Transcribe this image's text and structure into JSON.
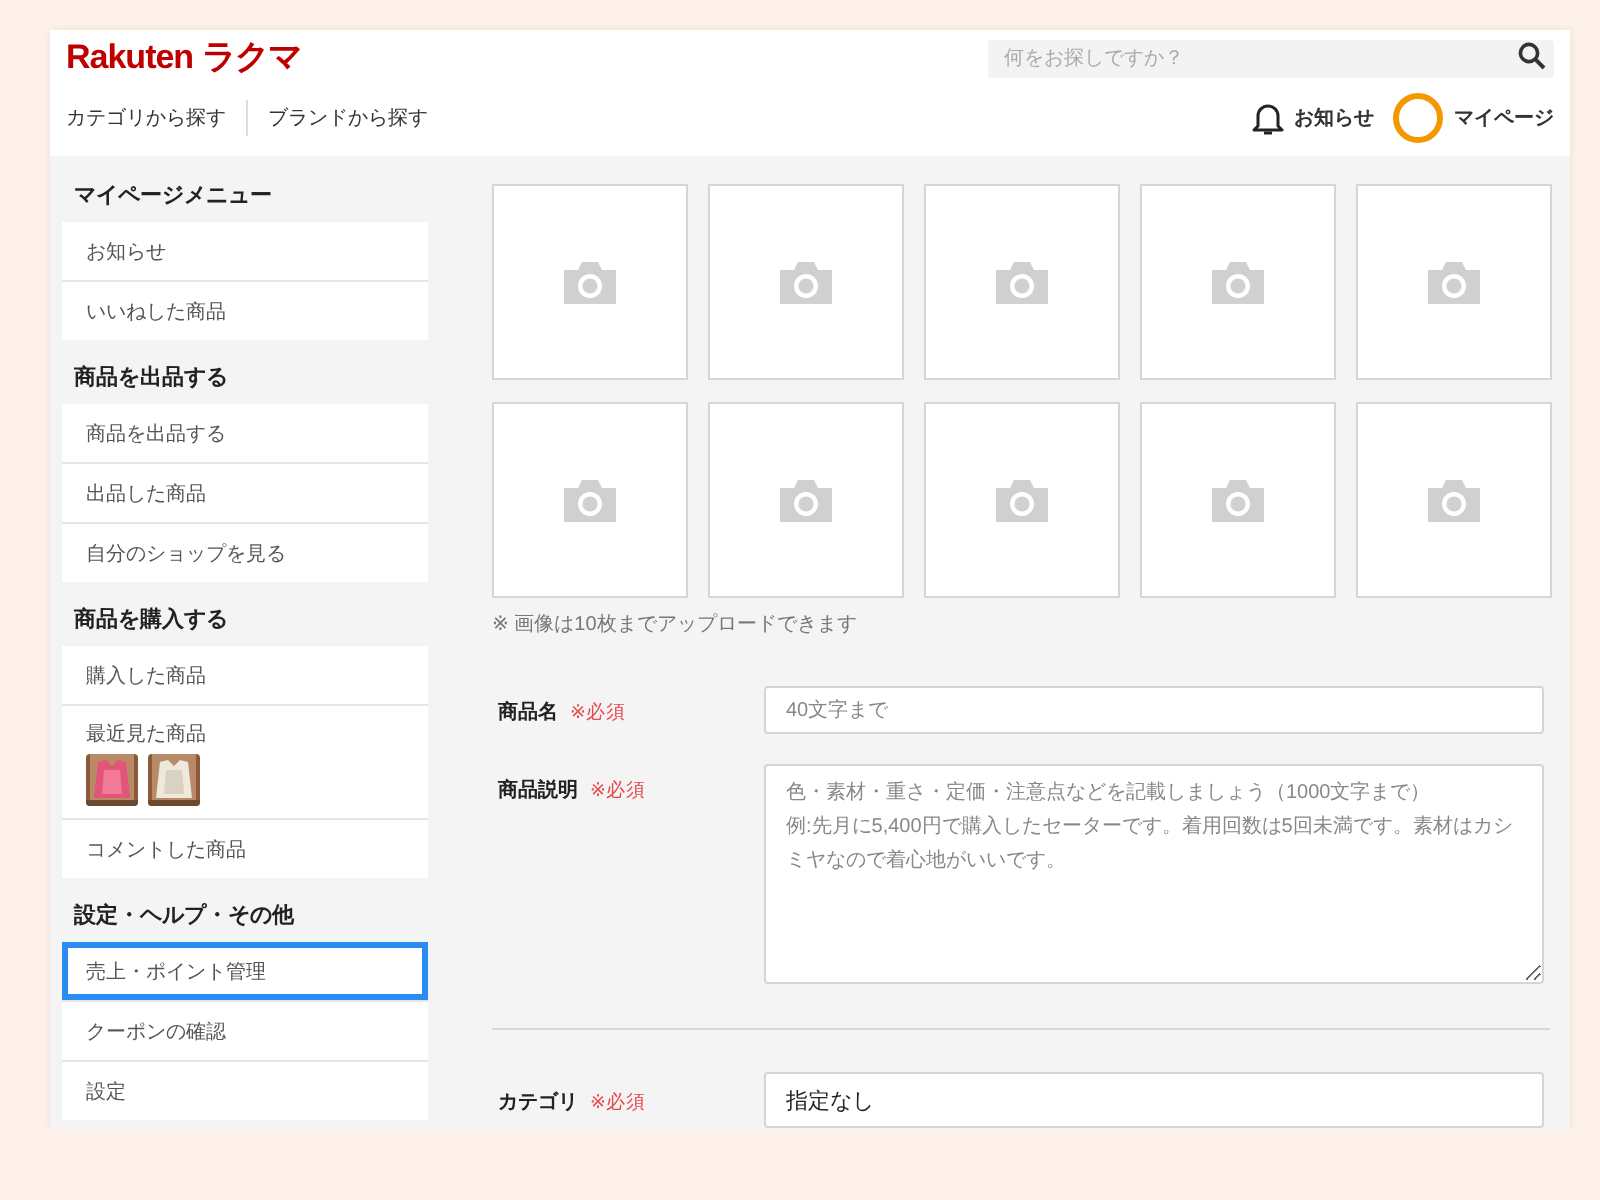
{
  "header": {
    "logo": "Rakuten ラクマ",
    "search": {
      "placeholder": "何をお探しですか？"
    },
    "nav": [
      "カテゴリから探す",
      "ブランドから探す"
    ],
    "notifications": "お知らせ",
    "mypage": "マイページ"
  },
  "sidebar": {
    "sections": [
      {
        "heading": "マイページメニュー",
        "items": [
          {
            "label": "お知らせ",
            "selected": false
          },
          {
            "label": "いいねした商品",
            "selected": false
          }
        ]
      },
      {
        "heading": "商品を出品する",
        "items": [
          {
            "label": "商品を出品する",
            "selected": false
          },
          {
            "label": "出品した商品",
            "selected": false
          },
          {
            "label": "自分のショップを見る",
            "selected": false
          }
        ]
      },
      {
        "heading": "商品を購入する",
        "items": [
          {
            "label": "購入した商品",
            "selected": false
          },
          {
            "label": "最近見た商品",
            "selected": false
          },
          {
            "label": "コメントした商品",
            "selected": false
          }
        ]
      },
      {
        "heading": "設定・ヘルプ・その他",
        "items": [
          {
            "label": "売上・ポイント管理",
            "selected": true
          },
          {
            "label": "クーポンの確認",
            "selected": false
          },
          {
            "label": "設定",
            "selected": false
          }
        ]
      }
    ]
  },
  "photos": {
    "slots": [
      {
        "kind": "empty"
      },
      {
        "kind": "empty"
      },
      {
        "kind": "empty"
      },
      {
        "kind": "empty"
      },
      {
        "kind": "empty"
      },
      {
        "kind": "empty"
      },
      {
        "kind": "empty"
      },
      {
        "kind": "empty"
      },
      {
        "kind": "empty"
      },
      {
        "kind": "empty"
      }
    ],
    "note": "※ 画像は10枚までアップロードできます"
  },
  "form": {
    "fields": [
      {
        "kind": "input",
        "label": "商品名",
        "required": "※必須",
        "placeholder": "40文字まで"
      },
      {
        "kind": "textarea",
        "label": "商品説明",
        "required": "※必須",
        "placeholder_lines": [
          "色・素材・重さ・定価・注意点などを記載しましょう（1000文字まで）",
          "例:先月に5,400円で購入したセーターです。着用回数は5回未満です。素材はカシミヤなので着心地がいいです。"
        ]
      },
      {
        "kind": "select",
        "label": "カテゴリ",
        "required": "※必須",
        "value": "指定なし"
      }
    ]
  }
}
